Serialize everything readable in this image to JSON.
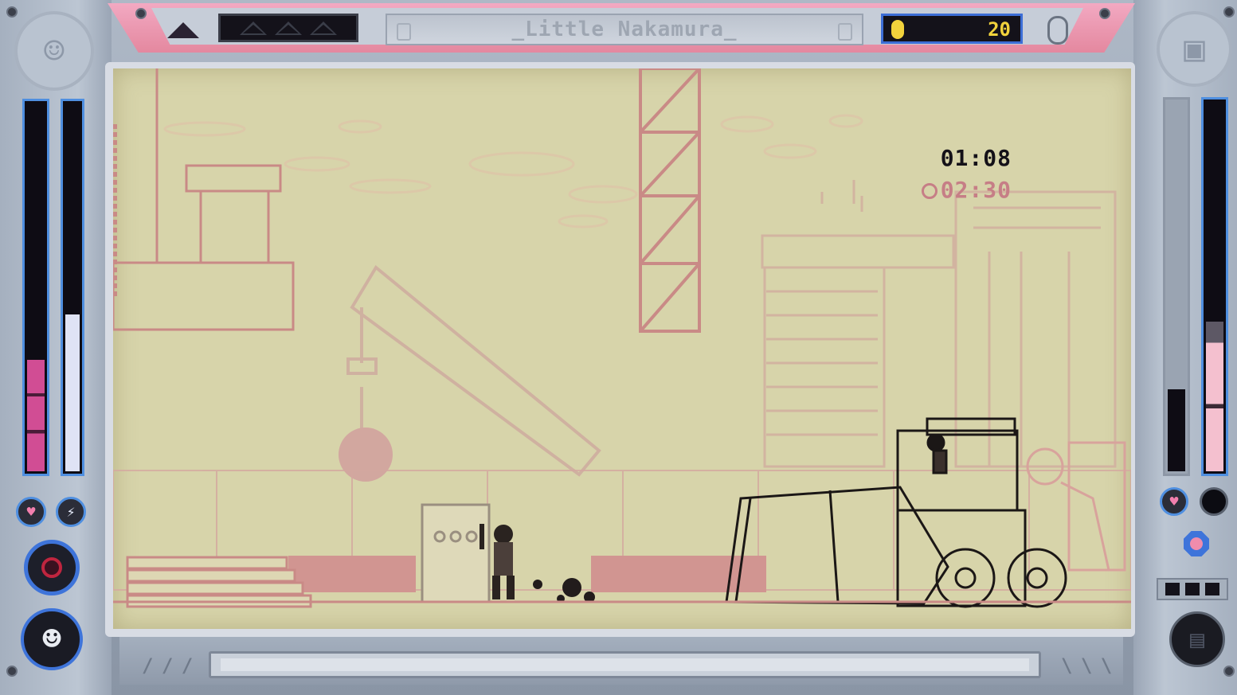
{
  "hud": {
    "level_name": "_Little Nakamura_",
    "coins": "20",
    "timer": "01:08",
    "best_time": "02:30",
    "lives_total": 3,
    "player_health_fraction": 0.3,
    "player_energy_fraction": 0.42,
    "boss_health_fraction": 0.4,
    "colors": {
      "accent_pink": "#e4889f",
      "accent_blue": "#3e74da",
      "lcd_background": "#d7d4aa",
      "coin_yellow": "#f1d23c"
    }
  },
  "icons": {
    "left_portrait": "bearded-man-icon",
    "right_portrait": "robot-face-icon",
    "health": "heart-icon",
    "energy": "lightning-icon",
    "coin": "coin-icon",
    "timer_best": "clock-icon"
  }
}
